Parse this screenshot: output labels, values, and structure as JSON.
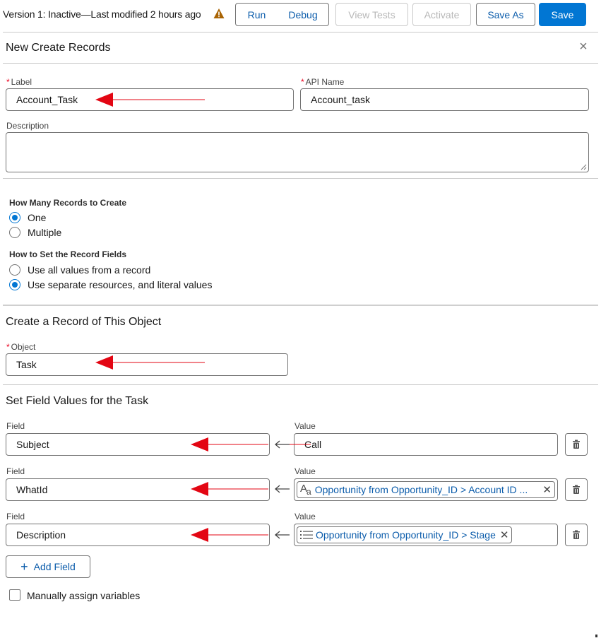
{
  "header": {
    "status": "Version 1: Inactive—Last modified 2 hours ago",
    "buttons": {
      "run": "Run",
      "debug": "Debug",
      "view_tests": "View Tests",
      "activate": "Activate",
      "save_as": "Save As",
      "save": "Save"
    }
  },
  "panel": {
    "title": "New Create Records",
    "close": "×"
  },
  "form": {
    "label": {
      "label": "Label",
      "value": "Account_Task"
    },
    "api_name": {
      "label": "API Name",
      "value": "Account_task"
    },
    "description": {
      "label": "Description",
      "value": ""
    }
  },
  "how_many": {
    "heading": "How Many Records to Create",
    "options": [
      {
        "label": "One",
        "selected": true
      },
      {
        "label": "Multiple",
        "selected": false
      }
    ]
  },
  "how_to_set": {
    "heading": "How to Set the Record Fields",
    "options": [
      {
        "label": "Use all values from a record",
        "selected": false
      },
      {
        "label": "Use separate resources, and literal values",
        "selected": true
      }
    ]
  },
  "object_section": {
    "title": "Create a Record of This Object",
    "object_label": "Object",
    "object_value": "Task"
  },
  "field_values": {
    "title": "Set Field Values for the Task",
    "field_label": "Field",
    "value_label": "Value",
    "rows": [
      {
        "field": "Subject",
        "value": "Call",
        "value_type": "text"
      },
      {
        "field": "WhatId",
        "value": "Opportunity from Opportunity_ID > Account ID ...",
        "value_type": "text-resource",
        "icon": "text-variable-icon"
      },
      {
        "field": "Description",
        "value": "Opportunity from Opportunity_ID > Stage",
        "value_type": "picklist-resource",
        "icon": "picklist-icon"
      }
    ],
    "add_field": "Add Field",
    "add_icon": "plus-icon"
  },
  "manual_assign": {
    "label": "Manually assign variables",
    "checked": false
  },
  "colors": {
    "brand": "#0176d3",
    "link": "#0b5cab",
    "required": "#ea001e",
    "annotation_arrow": "#e30613"
  }
}
